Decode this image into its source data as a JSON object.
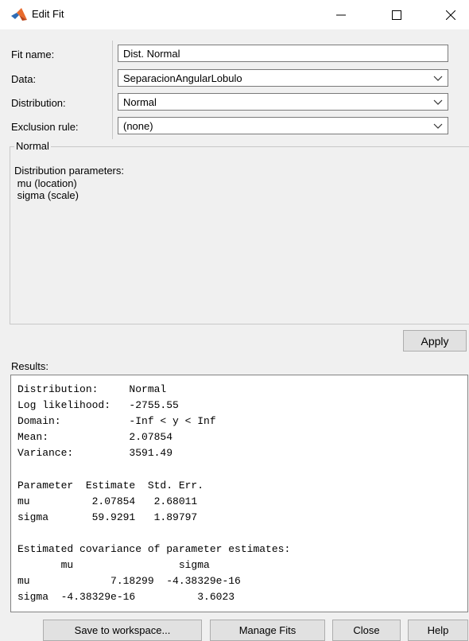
{
  "window": {
    "title": "Edit Fit"
  },
  "form": {
    "fit_name": {
      "label": "Fit name:",
      "value": "Dist. Normal"
    },
    "data": {
      "label": "Data:",
      "value": "SeparacionAngularLobulo"
    },
    "distribution": {
      "label": "Distribution:",
      "value": "Normal"
    },
    "exclusion_rule": {
      "label": "Exclusion rule:",
      "value": "(none)"
    }
  },
  "group": {
    "title": "Normal",
    "params_heading": "Distribution parameters:",
    "params": [
      "mu (location)",
      "sigma (scale)"
    ]
  },
  "apply_label": "Apply",
  "results": {
    "label": "Results:",
    "lines": [
      "Distribution:     Normal",
      "Log likelihood:   -2755.55",
      "Domain:           -Inf < y < Inf",
      "Mean:             2.07854",
      "Variance:         3591.49",
      "",
      "Parameter  Estimate  Std. Err.",
      "mu          2.07854   2.68011",
      "sigma       59.9291   1.89797",
      "",
      "Estimated covariance of parameter estimates:",
      "       mu                 sigma",
      "mu             7.18299  -4.38329e-16",
      "sigma  -4.38329e-16          3.6023"
    ]
  },
  "buttons": {
    "save": "Save to workspace...",
    "manage": "Manage Fits",
    "close": "Close",
    "help": "Help"
  },
  "colors": {
    "window_bg": "#f0f0f0",
    "button_bg": "#e1e1e1"
  }
}
